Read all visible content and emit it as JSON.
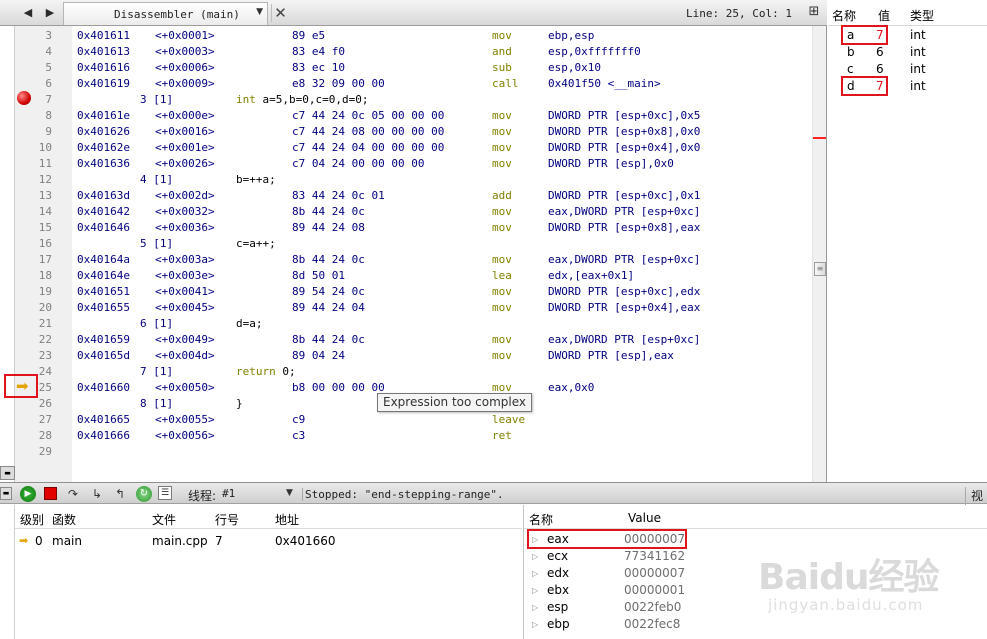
{
  "disassembler": {
    "tab_title": "Disassembler (main)",
    "line_col": "Line: 25, Col: 1",
    "lines": [
      {
        "ln": "3",
        "addr": "0x401611",
        "off": "<+0x0001>",
        "bytes": "89 e5",
        "mnem": "mov",
        "ops": "ebp,esp"
      },
      {
        "ln": "4",
        "addr": "0x401613",
        "off": "<+0x0003>",
        "bytes": "83 e4 f0",
        "mnem": "and",
        "ops": "esp,0xfffffff0"
      },
      {
        "ln": "5",
        "addr": "0x401616",
        "off": "<+0x0006>",
        "bytes": "83 ec 10",
        "mnem": "sub",
        "ops": "esp,0x10"
      },
      {
        "ln": "6",
        "addr": "0x401619",
        "off": "<+0x0009>",
        "bytes": "e8 32 09 00 00",
        "mnem": "call",
        "ops": "0x401f50 <__main>"
      },
      {
        "ln": "7",
        "src_line": "3 [1]",
        "src": "int a=5,b=0,c=0,d=0;"
      },
      {
        "ln": "8",
        "addr": "0x40161e",
        "off": "<+0x000e>",
        "bytes": "c7 44 24 0c 05 00 00 00",
        "mnem": "mov",
        "ops": "DWORD PTR [esp+0xc],0x5"
      },
      {
        "ln": "9",
        "addr": "0x401626",
        "off": "<+0x0016>",
        "bytes": "c7 44 24 08 00 00 00 00",
        "mnem": "mov",
        "ops": "DWORD PTR [esp+0x8],0x0"
      },
      {
        "ln": "10",
        "addr": "0x40162e",
        "off": "<+0x001e>",
        "bytes": "c7 44 24 04 00 00 00 00",
        "mnem": "mov",
        "ops": "DWORD PTR [esp+0x4],0x0"
      },
      {
        "ln": "11",
        "addr": "0x401636",
        "off": "<+0x0026>",
        "bytes": "c7 04 24 00 00 00 00",
        "mnem": "mov",
        "ops": "DWORD PTR [esp],0x0"
      },
      {
        "ln": "12",
        "src_line": "4 [1]",
        "src": "b=++a;"
      },
      {
        "ln": "13",
        "addr": "0x40163d",
        "off": "<+0x002d>",
        "bytes": "83 44 24 0c 01",
        "mnem": "add",
        "ops": "DWORD PTR [esp+0xc],0x1"
      },
      {
        "ln": "14",
        "addr": "0x401642",
        "off": "<+0x0032>",
        "bytes": "8b 44 24 0c",
        "mnem": "mov",
        "ops": "eax,DWORD PTR [esp+0xc]"
      },
      {
        "ln": "15",
        "addr": "0x401646",
        "off": "<+0x0036>",
        "bytes": "89 44 24 08",
        "mnem": "mov",
        "ops": "DWORD PTR [esp+0x8],eax"
      },
      {
        "ln": "16",
        "src_line": "5 [1]",
        "src": "c=a++;"
      },
      {
        "ln": "17",
        "addr": "0x40164a",
        "off": "<+0x003a>",
        "bytes": "8b 44 24 0c",
        "mnem": "mov",
        "ops": "eax,DWORD PTR [esp+0xc]"
      },
      {
        "ln": "18",
        "addr": "0x40164e",
        "off": "<+0x003e>",
        "bytes": "8d 50 01",
        "mnem": "lea",
        "ops": "edx,[eax+0x1]"
      },
      {
        "ln": "19",
        "addr": "0x401651",
        "off": "<+0x0041>",
        "bytes": "89 54 24 0c",
        "mnem": "mov",
        "ops": "DWORD PTR [esp+0xc],edx"
      },
      {
        "ln": "20",
        "addr": "0x401655",
        "off": "<+0x0045>",
        "bytes": "89 44 24 04",
        "mnem": "mov",
        "ops": "DWORD PTR [esp+0x4],eax"
      },
      {
        "ln": "21",
        "src_line": "6 [1]",
        "src": "d=a;"
      },
      {
        "ln": "22",
        "addr": "0x401659",
        "off": "<+0x0049>",
        "bytes": "8b 44 24 0c",
        "mnem": "mov",
        "ops": "eax,DWORD PTR [esp+0xc]"
      },
      {
        "ln": "23",
        "addr": "0x40165d",
        "off": "<+0x004d>",
        "bytes": "89 04 24",
        "mnem": "mov",
        "ops": "DWORD PTR [esp],eax"
      },
      {
        "ln": "24",
        "src_line": "7 [1]",
        "src": "return 0;"
      },
      {
        "ln": "25",
        "addr": "0x401660",
        "off": "<+0x0050>",
        "bytes": "b8 00 00 00 00",
        "mnem": "mov",
        "ops": "eax,0x0"
      },
      {
        "ln": "26",
        "src_line": "8 [1]",
        "src": "}"
      },
      {
        "ln": "27",
        "addr": "0x401665",
        "off": "<+0x0055>",
        "bytes": "c9",
        "mnem": "leave",
        "ops": ""
      },
      {
        "ln": "28",
        "addr": "0x401666",
        "off": "<+0x0056>",
        "bytes": "c3",
        "mnem": "ret",
        "ops": ""
      },
      {
        "ln": "29"
      }
    ],
    "tooltip": "Expression too complex"
  },
  "locals": {
    "headers": {
      "name": "名称",
      "value": "值",
      "type": "类型"
    },
    "rows": [
      {
        "name": "a",
        "value": "7",
        "type": "int",
        "changed": true
      },
      {
        "name": "b",
        "value": "6",
        "type": "int",
        "changed": false
      },
      {
        "name": "c",
        "value": "6",
        "type": "int",
        "changed": false
      },
      {
        "name": "d",
        "value": "7",
        "type": "int",
        "changed": true
      }
    ]
  },
  "toolbar": {
    "thread_label": "线程:",
    "thread_value": "#1",
    "status": "Stopped: \"end-stepping-range\".",
    "view_label": "视图"
  },
  "callstack": {
    "headers": {
      "level": "级别",
      "function": "函数",
      "file": "文件",
      "line": "行号",
      "address": "地址"
    },
    "rows": [
      {
        "level": "0",
        "function": "main",
        "file": "main.cpp",
        "line": "7",
        "address": "0x401660"
      }
    ]
  },
  "registers": {
    "headers": {
      "name": "名称",
      "value": "Value"
    },
    "rows": [
      {
        "name": "eax",
        "value": "00000007"
      },
      {
        "name": "ecx",
        "value": "77341162"
      },
      {
        "name": "edx",
        "value": "00000007"
      },
      {
        "name": "ebx",
        "value": "00000001"
      },
      {
        "name": "esp",
        "value": "0022feb0"
      },
      {
        "name": "ebp",
        "value": "0022fec8"
      }
    ]
  },
  "watermark": {
    "main": "Baidu经验",
    "sub": "jingyan.baidu.com"
  }
}
